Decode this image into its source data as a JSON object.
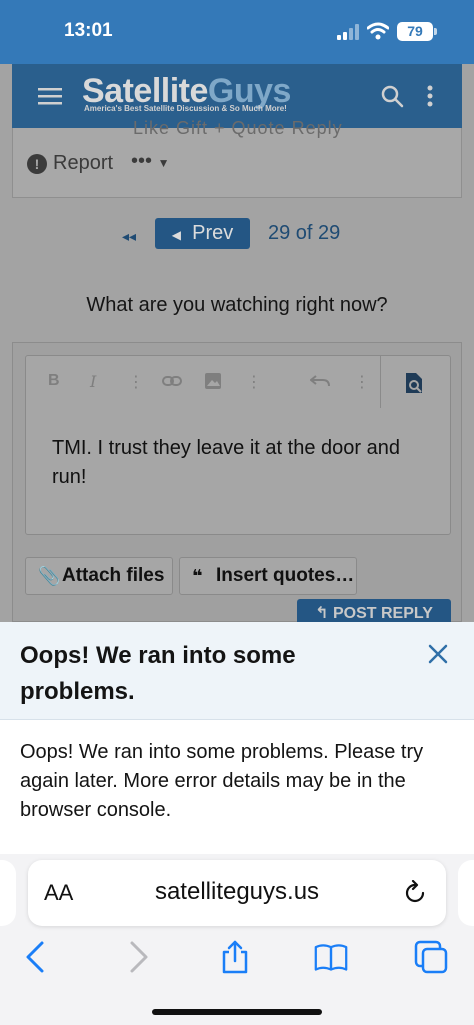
{
  "status_bar": {
    "time": "13:01",
    "battery": "79"
  },
  "site_header": {
    "logo_main": "Satellite",
    "logo_accent": "Guys",
    "tagline": "America's Best Satellite Discussion & So Much More!"
  },
  "post_actions": {
    "faded_text": "Like   Gift   + Quote   Reply",
    "report": "Report",
    "more": "•••"
  },
  "pagination": {
    "first": "◂◂",
    "prev": "Prev",
    "count": "29 of 29"
  },
  "thread_title": "What are you watching right now?",
  "editor": {
    "content": "TMI. I trust they leave it at the door and run!",
    "toolbar": {
      "bold": "B",
      "italic": "I",
      "more1": "⋮",
      "link": "link",
      "image": "image",
      "more2": "⋮",
      "undo": "undo",
      "more3": "⋮"
    }
  },
  "buttons": {
    "attach": "Attach files",
    "insert_quotes": "Insert quotes…",
    "post_reply": "POST REPLY"
  },
  "error_sheet": {
    "title": "Oops! We ran into some problems.",
    "message": "Oops! We ran into some problems. Please try again later. More error details may be in the browser console."
  },
  "browser": {
    "aa": "AA",
    "url": "satelliteguys.us"
  },
  "colors": {
    "brand_blue": "#3479b8",
    "dim_blue": "#245684",
    "sheet_head": "#eef4f9",
    "ios_blue": "#1a7ef7"
  }
}
